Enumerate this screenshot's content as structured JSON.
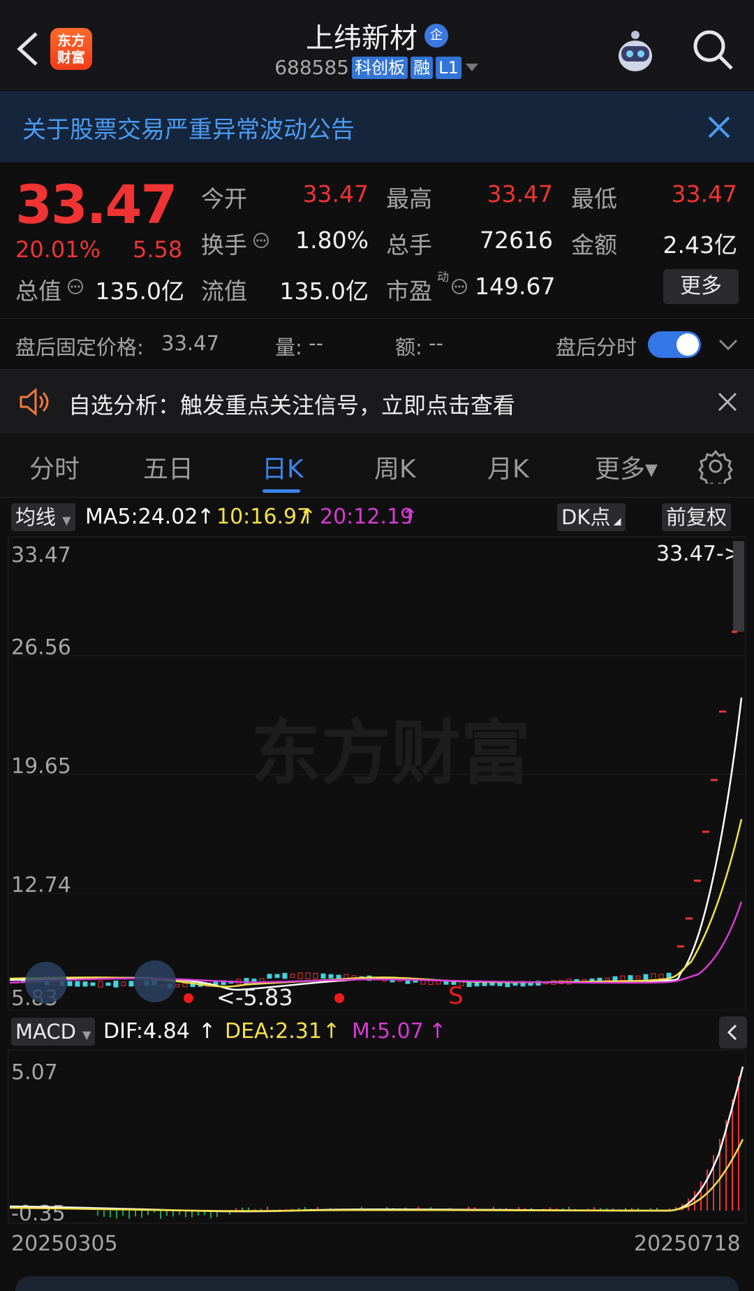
{
  "header": {
    "logo_text": "东方\n财富",
    "stock_name": "上纬新材",
    "qi_badge": "企",
    "code": "688585",
    "tags": [
      "科创板",
      "融",
      "L1"
    ]
  },
  "notice": {
    "text": "关于股票交易严重异常波动公告"
  },
  "quote": {
    "price": "33.47",
    "change_pct": "20.01%",
    "change": "5.58",
    "items": [
      {
        "label": "今开",
        "value": "33.47",
        "color": "#f03433"
      },
      {
        "label": "最高",
        "value": "33.47",
        "color": "#f03433"
      },
      {
        "label": "最低",
        "value": "33.47",
        "color": "#f03433"
      },
      {
        "label": "换手",
        "value": "1.80%",
        "color": "#f2f2f2"
      },
      {
        "label": "总手",
        "value": "72616",
        "color": "#f2f2f2"
      },
      {
        "label": "金额",
        "value": "2.43亿",
        "color": "#f2f2f2"
      },
      {
        "label": "总值",
        "value": "135.0亿",
        "color": "#f2f2f2"
      },
      {
        "label": "流值",
        "value": "135.0亿",
        "color": "#f2f2f2"
      },
      {
        "label": "市盈",
        "value": "149.67",
        "color": "#f2f2f2"
      }
    ],
    "pe_superscript": "动",
    "more_label": "更多"
  },
  "after_hours": {
    "fixed_price_label": "盘后固定价格:",
    "fixed_price": "33.47",
    "volume_label": "量:",
    "volume": "--",
    "amount_label": "额:",
    "amount": "--",
    "toggle_label": "盘后分时",
    "toggle_on": true
  },
  "signal": {
    "text": "自选分析：触发重点关注信号，立即点击查看"
  },
  "tabs": [
    "分时",
    "五日",
    "日K",
    "周K",
    "月K",
    "更多▾"
  ],
  "active_tab": "日K",
  "ma": {
    "selector": "均线",
    "ma5": "MA5:24.02",
    "ma10": "10:16.97",
    "ma20": "20:12.19",
    "dk_label": "DK点",
    "adjust_label": "前复权",
    "colors": {
      "ma5": "#ffffff",
      "ma10": "#f5e04a",
      "ma20": "#d63ad2"
    }
  },
  "kchart": {
    "y_labels": [
      "33.47",
      "26.56",
      "19.65",
      "12.74",
      "5.83"
    ],
    "last_price_label": "33.47->",
    "low_label": "<-5.83",
    "watermark": "东方财富",
    "signal_s": "S"
  },
  "macd": {
    "selector": "MACD",
    "dif": "DIF:4.84",
    "dea": "DEA:2.31",
    "m": "M:5.07",
    "y_labels": [
      "5.07",
      "-0.35"
    ],
    "colors": {
      "dif": "#ffffff",
      "dea": "#f5e04a",
      "m": "#d63ad2"
    }
  },
  "dates": {
    "start": "20250305",
    "end": "20250718"
  }
}
